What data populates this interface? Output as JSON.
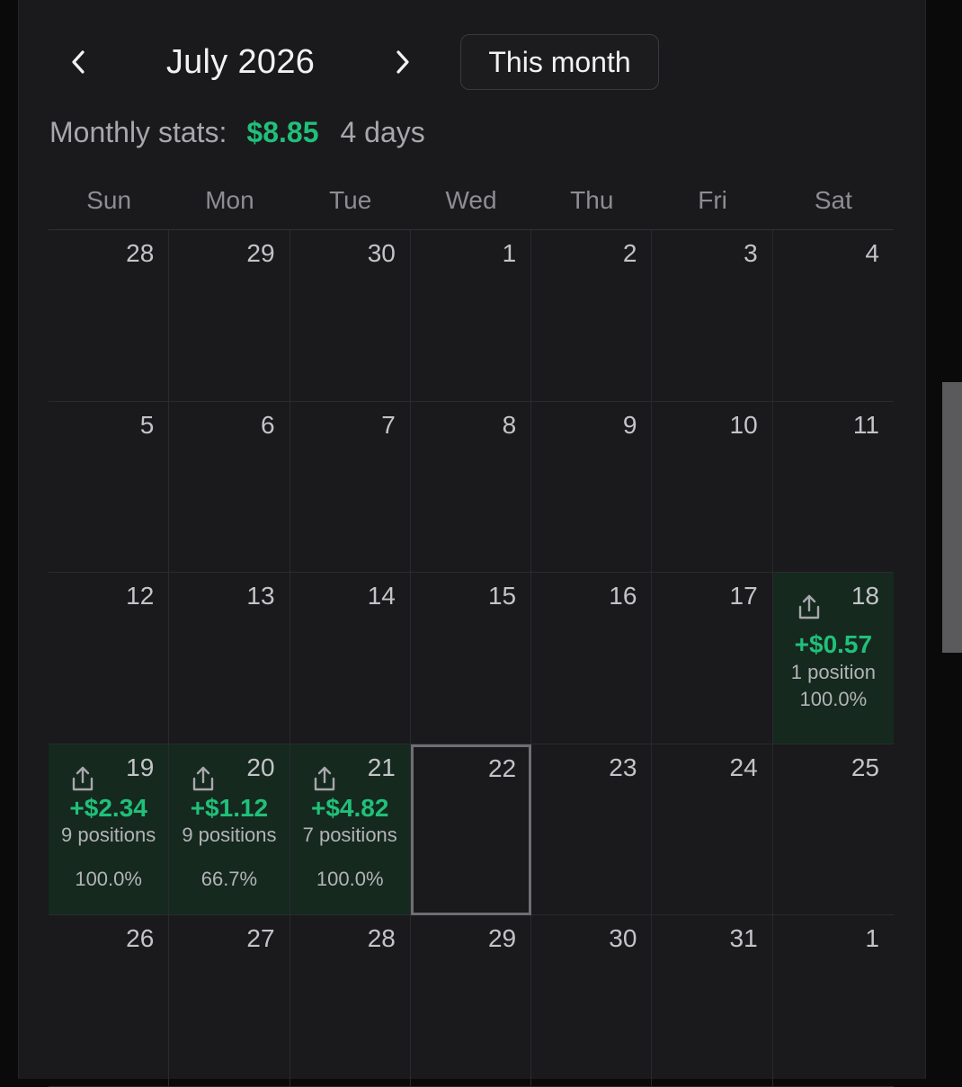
{
  "header": {
    "prev_icon": "chevron-left-icon",
    "next_icon": "chevron-right-icon",
    "month_title": "July 2026",
    "this_month_label": "This month"
  },
  "stats": {
    "label": "Monthly stats:",
    "amount": "$8.85",
    "days": "4 days"
  },
  "colors": {
    "profit_green": "#21c07a",
    "profit_cell_bg": "#15291f",
    "panel_bg": "#1a1a1c"
  },
  "weekdays": [
    "Sun",
    "Mon",
    "Tue",
    "Wed",
    "Thu",
    "Fri",
    "Sat"
  ],
  "days": [
    {
      "date": "28"
    },
    {
      "date": "29"
    },
    {
      "date": "30"
    },
    {
      "date": "1"
    },
    {
      "date": "2"
    },
    {
      "date": "3"
    },
    {
      "date": "4"
    },
    {
      "date": "5"
    },
    {
      "date": "6"
    },
    {
      "date": "7"
    },
    {
      "date": "8"
    },
    {
      "date": "9"
    },
    {
      "date": "10"
    },
    {
      "date": "11"
    },
    {
      "date": "12"
    },
    {
      "date": "13"
    },
    {
      "date": "14"
    },
    {
      "date": "15"
    },
    {
      "date": "16"
    },
    {
      "date": "17"
    },
    {
      "date": "18",
      "pnl": "+$0.57",
      "positions": "1 position",
      "pct": "100.0%",
      "layout": "wide"
    },
    {
      "date": "19",
      "pnl": "+$2.34",
      "positions": "9 positions",
      "pct": "100.0%",
      "layout": "narrow"
    },
    {
      "date": "20",
      "pnl": "+$1.12",
      "positions": "9 positions",
      "pct": "66.7%",
      "layout": "narrow"
    },
    {
      "date": "21",
      "pnl": "+$4.82",
      "positions": "7 positions",
      "pct": "100.0%",
      "layout": "narrow"
    },
    {
      "date": "22",
      "today": true
    },
    {
      "date": "23"
    },
    {
      "date": "24"
    },
    {
      "date": "25"
    },
    {
      "date": "26"
    },
    {
      "date": "27"
    },
    {
      "date": "28"
    },
    {
      "date": "29"
    },
    {
      "date": "30"
    },
    {
      "date": "31"
    },
    {
      "date": "1"
    }
  ],
  "share_icon": "share-icon"
}
